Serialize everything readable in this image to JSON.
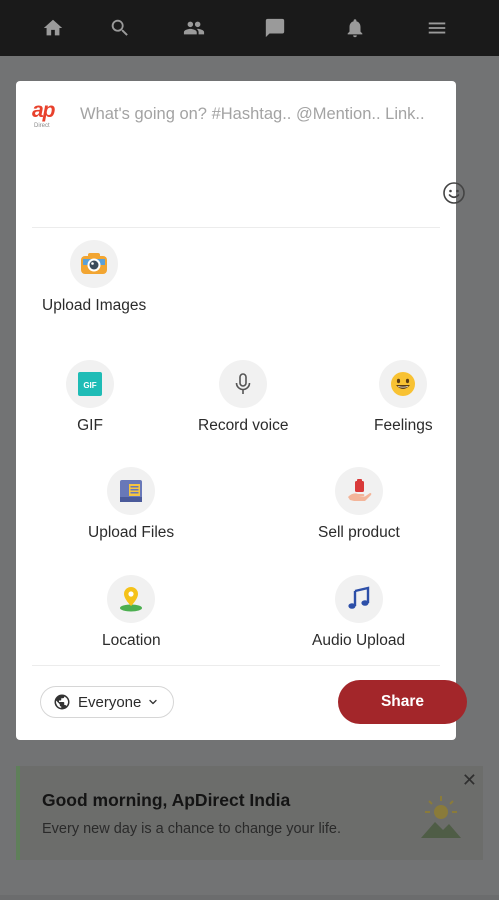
{
  "nav": {
    "icons": [
      "home-icon",
      "search-icon",
      "people-icon",
      "chat-icon",
      "bell-icon",
      "menu-icon"
    ]
  },
  "composer": {
    "logo": "ap",
    "placeholder": "What's going on? #Hashtag.. @Mention.. Link..",
    "options": {
      "upload_images": "Upload Images",
      "gif": "GIF",
      "record_voice": "Record voice",
      "feelings": "Feelings",
      "upload_files": "Upload Files",
      "sell_product": "Sell product",
      "location": "Location",
      "audio_upload": "Audio Upload"
    },
    "privacy": "Everyone",
    "share": "Share"
  },
  "greeting": {
    "title": "Good morning, ApDirect India",
    "subtitle": "Every new day is a chance to change your life.",
    "close": "✕"
  },
  "colors": {
    "nav_bg": "#1a1a1a",
    "share_bg": "#a3262a",
    "logo": "#e8412c"
  }
}
